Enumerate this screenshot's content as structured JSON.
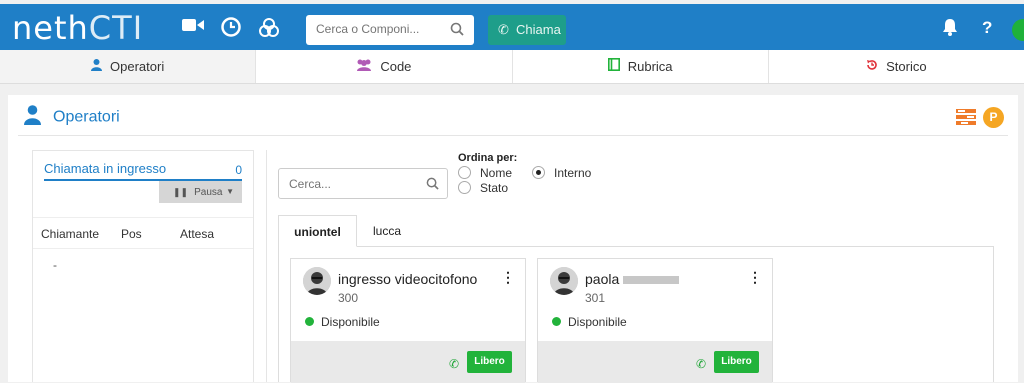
{
  "app": {
    "logo_text": "neth",
    "logo_suffix": "CTI"
  },
  "topbar": {
    "search_placeholder": "Cerca o Componi...",
    "call_label": "Chiama",
    "help_label": "?"
  },
  "tabs": [
    {
      "label": "Operatori",
      "icon": "user-icon",
      "color": "#1f7fc7"
    },
    {
      "label": "Code",
      "icon": "users-icon",
      "color": "#b15ab6"
    },
    {
      "label": "Rubrica",
      "icon": "book-icon",
      "color": "#22b33b"
    },
    {
      "label": "Storico",
      "icon": "history-icon",
      "color": "#e0343c"
    }
  ],
  "panel": {
    "title": "Operatori",
    "badge_letter": "P"
  },
  "queue": {
    "title": "Chiamata in ingresso",
    "count": "0",
    "pause_label": "Pausa",
    "columns": [
      "Chiamante",
      "Pos",
      "Attesa"
    ],
    "empty": "-"
  },
  "operators_filter": {
    "search_placeholder": "Cerca...",
    "sort_title": "Ordina per:",
    "sort_options": [
      {
        "label": "Nome",
        "selected": false
      },
      {
        "label": "Stato",
        "selected": false
      },
      {
        "label": "Interno",
        "selected": true
      }
    ]
  },
  "group_tabs": [
    {
      "label": "uniontel",
      "active": true
    },
    {
      "label": "lucca",
      "active": false
    }
  ],
  "operators": [
    {
      "name": "ingresso videocitofono",
      "extension": "300",
      "status": "Disponibile",
      "action": "Libero"
    },
    {
      "name": "paola",
      "extension": "301",
      "status": "Disponibile",
      "action": "Libero"
    }
  ],
  "colors": {
    "brand": "#1f7fc7",
    "call_button": "#1e9e8a",
    "available": "#22b33b",
    "badge": "#f5a623"
  }
}
